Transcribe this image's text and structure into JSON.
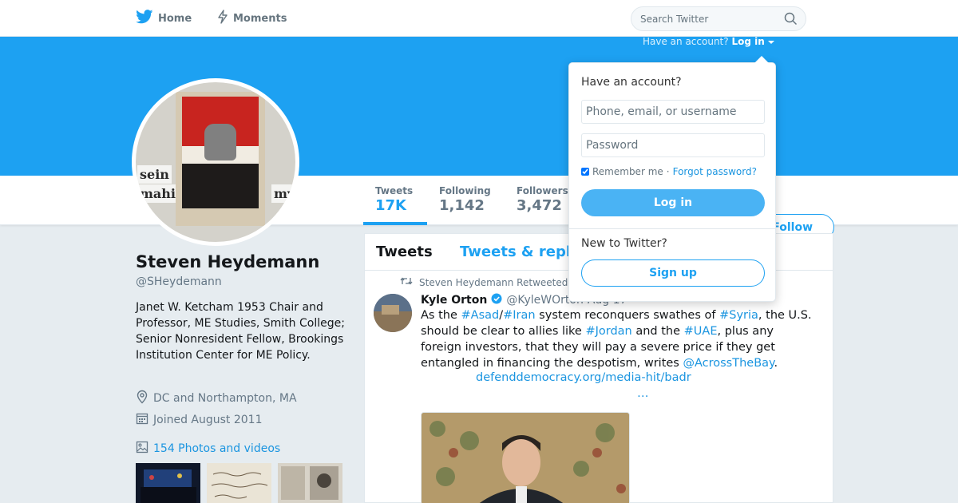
{
  "nav": {
    "home_label": "Home",
    "moments_label": "Moments",
    "search_placeholder": "Search Twitter",
    "login_prompt": "Have an account?",
    "login_link": "Log in"
  },
  "colors": {
    "brand": "#1da1f2",
    "link": "#1b95e0",
    "login_button": "#4ab3f4"
  },
  "profile": {
    "name": "Steven Heydemann",
    "handle": "@SHeydemann",
    "bio": "Janet W. Ketcham 1953 Chair and Professor, ME Studies, Smith College; Senior Nonresident Fellow, Brookings Institution Center for ME Policy.",
    "location": "DC and Northampton, MA",
    "joined": "Joined August 2011",
    "photos_label": "154 Photos and videos",
    "avatar_side_text": [
      "sein",
      "mahi",
      "my"
    ]
  },
  "stats": [
    {
      "label": "Tweets",
      "value": "17K"
    },
    {
      "label": "Following",
      "value": "1,142"
    },
    {
      "label": "Followers",
      "value": "3,472"
    }
  ],
  "follow_label": "Follow",
  "timeline": {
    "tabs": [
      "Tweets",
      "Tweets & repl"
    ],
    "retweet_context": "Steven Heydemann Retweeted",
    "tweet": {
      "author_name": "Kyle Orton",
      "author_handle": "@KyleWOrton",
      "date": "Aug 17",
      "text_parts": [
        {
          "t": "As the ",
          "tag": false
        },
        {
          "t": "#Asad",
          "tag": true
        },
        {
          "t": "/",
          "tag": false
        },
        {
          "t": "#Iran",
          "tag": true
        },
        {
          "t": " system reconquers swathes of ",
          "tag": false
        },
        {
          "t": "#Syria",
          "tag": true
        },
        {
          "t": ", the U.S. should be clear to allies like ",
          "tag": false
        },
        {
          "t": "#Jordan",
          "tag": true
        },
        {
          "t": " and the ",
          "tag": false
        },
        {
          "t": "#UAE",
          "tag": true
        },
        {
          "t": ", plus any foreign investors, that they will pay a severe price if they get entangled in financing the despotism, writes ",
          "tag": false
        },
        {
          "t": "@AcrossTheBay",
          "tag": true
        },
        {
          "t": ".",
          "tag": false
        }
      ],
      "link": "defenddemocracy.org/media-hit/badr",
      "ellipsis": "…"
    }
  },
  "login_dropdown": {
    "heading": "Have an account?",
    "username_placeholder": "Phone, email, or username",
    "password_placeholder": "Password",
    "remember_label": "Remember me",
    "separator": "·",
    "forgot_label": "Forgot password?",
    "login_button": "Log in",
    "new_prompt": "New to Twitter?",
    "signup_button": "Sign up"
  }
}
